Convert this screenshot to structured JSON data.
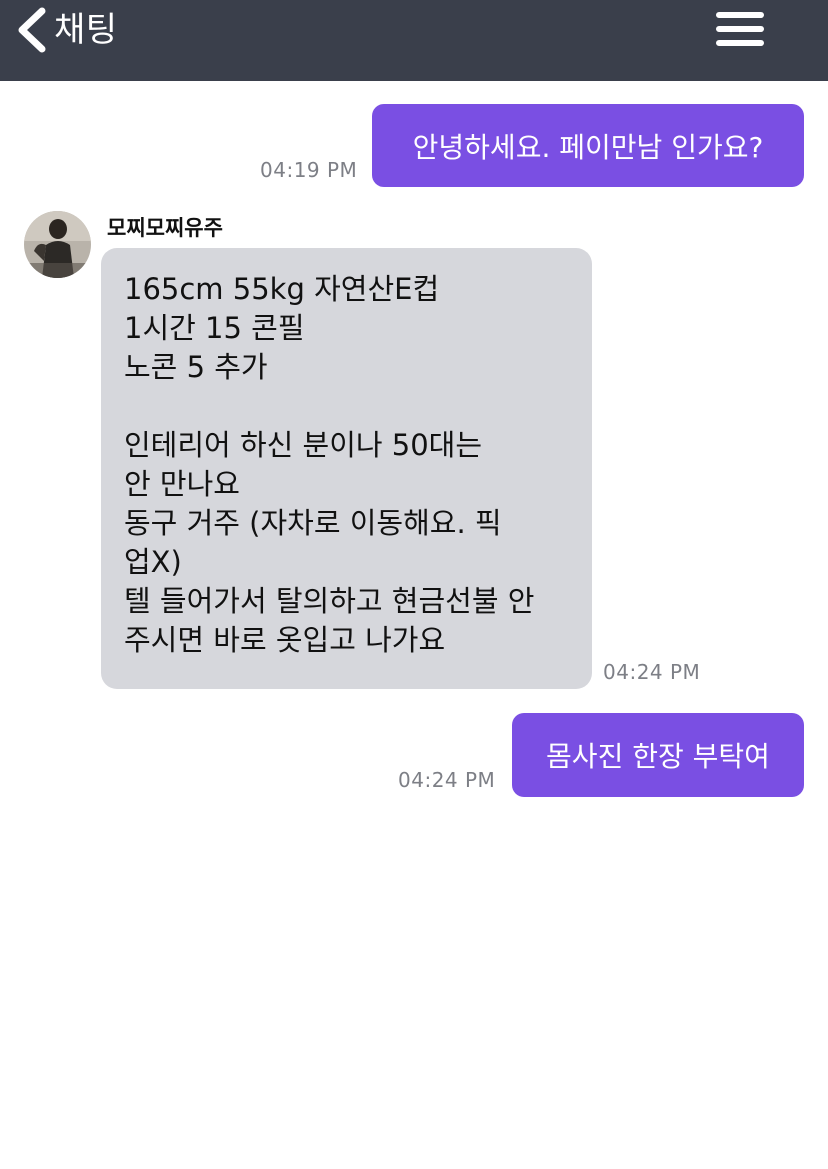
{
  "header": {
    "back_label": "채팅",
    "menu_icon": "hamburger-menu-icon",
    "background": "#3a3f4b"
  },
  "messages": [
    {
      "direction": "out",
      "text": "안녕하세요. 페이만남 인가요?",
      "time": "04:19 PM"
    },
    {
      "direction": "in",
      "sender": "모찌모찌유주",
      "text": "165cm 55kg 자연산E컵\n1시간 15 콘필\n노콘 5 추가\n\n인테리어 하신 분이나 50대는\n안 만나요\n동구 거주 (자차로 이동해요. 픽\n업X)\n텔 들어가서 탈의하고 현금선불 안\n주시면 바로 옷입고 나가요",
      "time": "04:24 PM"
    },
    {
      "direction": "out",
      "text": "몸사진 한장 부탁여",
      "time": "04:24 PM"
    }
  ],
  "colors": {
    "outgoing_bubble": "#7a4fe3",
    "incoming_bubble": "#d6d7dc",
    "timestamp": "#7d7f86"
  }
}
